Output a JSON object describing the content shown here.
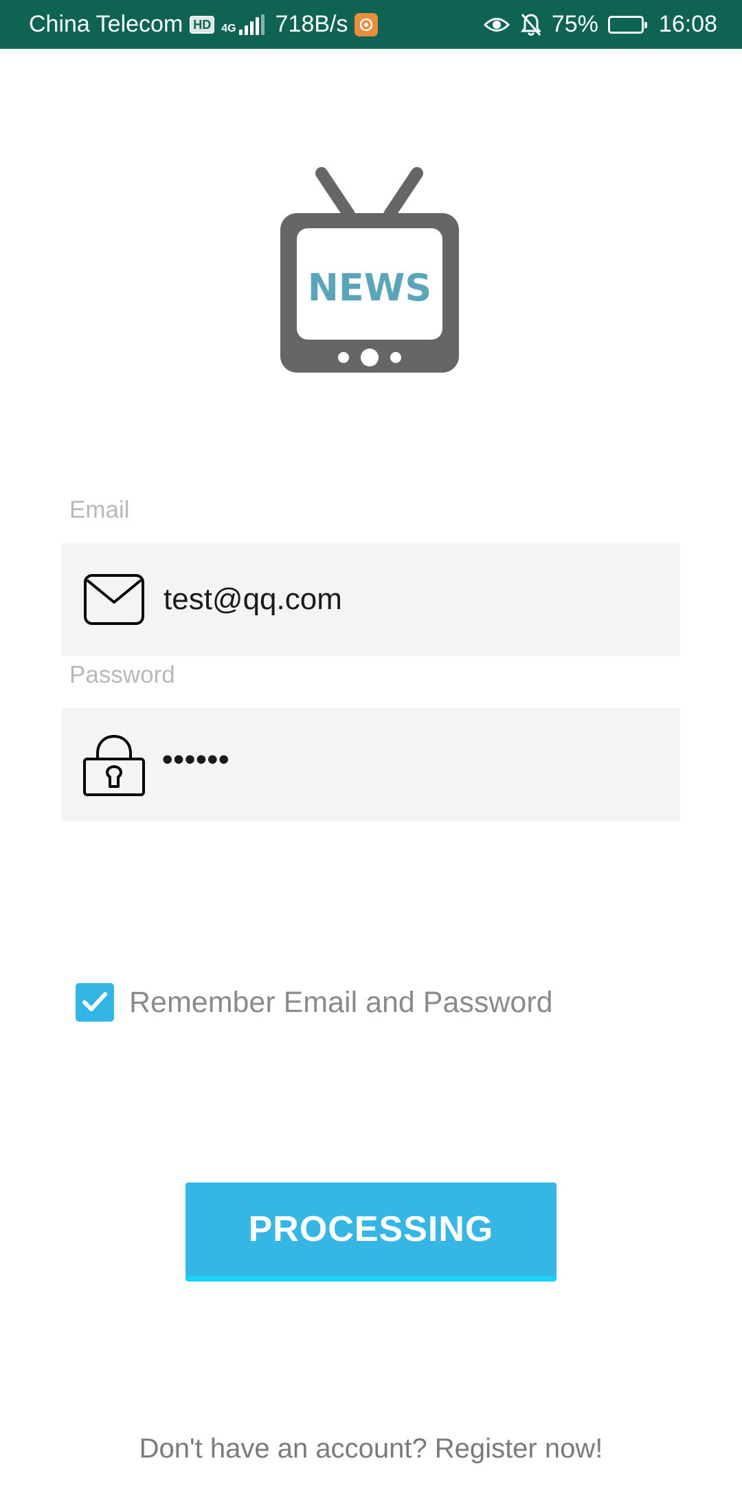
{
  "status_bar": {
    "carrier": "China Telecom",
    "hd": "HD",
    "network": "4G",
    "speed": "718B/s",
    "battery": "75%",
    "battery_level": 0.75,
    "time": "16:08"
  },
  "logo": {
    "text": "NEWS",
    "text_color": "#5aa5b9",
    "tv_color": "#666666"
  },
  "email": {
    "label": "Email",
    "value": "test@qq.com"
  },
  "password": {
    "label": "Password",
    "value": "••••••"
  },
  "remember": {
    "label": "Remember Email and Password",
    "checked": true
  },
  "button": {
    "label": "PROCESSING"
  },
  "register": {
    "text": "Don't have an account? Register now!"
  },
  "icons": {
    "email": "mail-icon",
    "password": "lock-icon",
    "check": "check-icon",
    "eye": "eye-icon",
    "bell": "bell-off-icon"
  },
  "colors": {
    "status_bar": "#065d4d",
    "accent": "#36b6e5",
    "field_bg": "#f4f4f4"
  }
}
